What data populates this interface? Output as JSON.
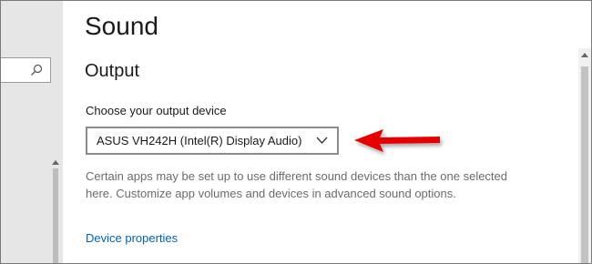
{
  "page": {
    "title": "Sound"
  },
  "output": {
    "heading": "Output",
    "device_label": "Choose your output device",
    "selected_device": "ASUS VH242H (Intel(R) Display Audio)",
    "description": "Certain apps may be set up to use different sound devices than the one selected here. Customize app volumes and devices in advanced sound options.",
    "device_properties_link": "Device properties"
  },
  "colors": {
    "annotation_arrow": "#e60000",
    "link": "#0063b1",
    "left_pane_bg": "#e6e6e6"
  },
  "icons": {
    "search": "search-icon",
    "dropdown": "chevron-down-icon"
  }
}
